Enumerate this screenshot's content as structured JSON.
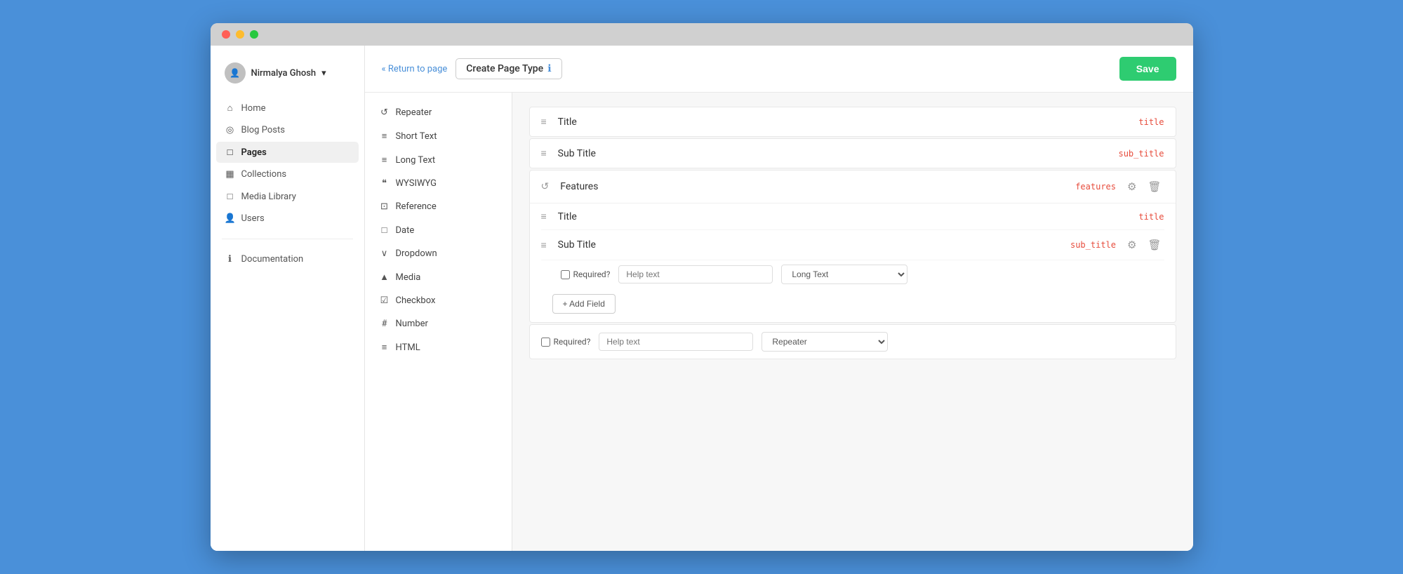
{
  "browser": {
    "dots": [
      "red",
      "yellow",
      "green"
    ]
  },
  "sidebar": {
    "user": {
      "name": "Nirmalya Ghosh",
      "dropdown_icon": "▾"
    },
    "nav_items": [
      {
        "id": "home",
        "label": "Home",
        "icon": "⌂",
        "active": false
      },
      {
        "id": "blog-posts",
        "label": "Blog Posts",
        "icon": "◎",
        "active": false
      },
      {
        "id": "pages",
        "label": "Pages",
        "icon": "📄",
        "active": true
      },
      {
        "id": "collections",
        "label": "Collections",
        "icon": "▦",
        "active": false
      },
      {
        "id": "media-library",
        "label": "Media Library",
        "icon": "🖼",
        "active": false
      },
      {
        "id": "users",
        "label": "Users",
        "icon": "👤",
        "active": false
      }
    ],
    "bottom_items": [
      {
        "id": "documentation",
        "label": "Documentation",
        "icon": "ℹ"
      }
    ]
  },
  "header": {
    "return_link": "Return to page",
    "page_title": "Create Page Type",
    "info_icon": "ℹ",
    "save_button": "Save"
  },
  "palette": {
    "items": [
      {
        "id": "repeater",
        "label": "Repeater",
        "icon": "↺"
      },
      {
        "id": "short-text",
        "label": "Short Text",
        "icon": "≡"
      },
      {
        "id": "long-text",
        "label": "Long Text",
        "icon": "≡"
      },
      {
        "id": "wysiwyg",
        "label": "WYSIWYG",
        "icon": "❝"
      },
      {
        "id": "reference",
        "label": "Reference",
        "icon": "⊡"
      },
      {
        "id": "date",
        "label": "Date",
        "icon": "📅"
      },
      {
        "id": "dropdown",
        "label": "Dropdown",
        "icon": "∨"
      },
      {
        "id": "media",
        "label": "Media",
        "icon": "▲"
      },
      {
        "id": "checkbox",
        "label": "Checkbox",
        "icon": "☑"
      },
      {
        "id": "number",
        "label": "Number",
        "icon": "#"
      },
      {
        "id": "html",
        "label": "HTML",
        "icon": "≡"
      }
    ]
  },
  "builder": {
    "fields": [
      {
        "id": "title-field",
        "icon": "≡",
        "name": "Title",
        "key": "title",
        "has_actions": false
      },
      {
        "id": "subtitle-field",
        "icon": "≡",
        "name": "Sub Title",
        "key": "sub_title",
        "has_actions": false
      }
    ],
    "repeater": {
      "id": "features-repeater",
      "icon": "↺",
      "name": "Features",
      "key": "features",
      "sub_fields": [
        {
          "id": "rep-title",
          "icon": "≡",
          "name": "Title",
          "key": "title",
          "has_actions": false
        },
        {
          "id": "rep-subtitle",
          "icon": "≡",
          "name": "Sub Title",
          "key": "sub_title",
          "has_actions": true,
          "options": {
            "required_label": "Required?",
            "help_placeholder": "Help text",
            "type_value": "Long Text",
            "type_options": [
              "Short Text",
              "Long Text",
              "WYSIWYG",
              "Reference",
              "Date",
              "Dropdown",
              "Media",
              "Checkbox",
              "Number",
              "HTML"
            ]
          }
        }
      ],
      "add_field_label": "+ Add Field"
    },
    "bottom_field": {
      "required_label": "Required?",
      "help_placeholder": "Help text",
      "type_value": "Repeater",
      "type_options": [
        "Repeater",
        "Short Text",
        "Long Text",
        "WYSIWYG",
        "Reference",
        "Date",
        "Dropdown",
        "Media",
        "Checkbox",
        "Number",
        "HTML"
      ]
    }
  }
}
